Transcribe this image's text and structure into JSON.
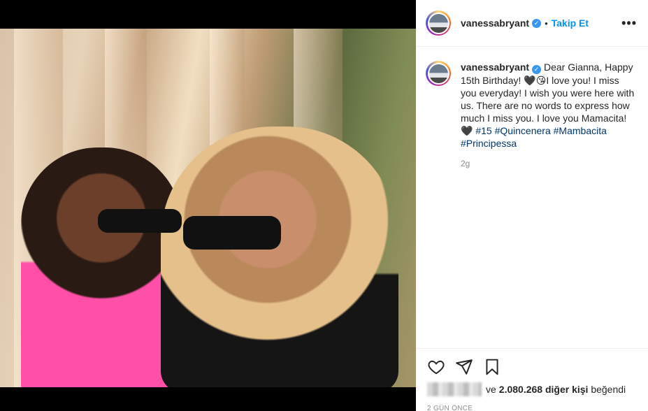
{
  "post": {
    "username": "vanessabryant",
    "follow_label": "Takip Et",
    "separator": "•",
    "more_label": "•••",
    "caption_username": "vanessabryant",
    "caption_text_1": "Dear Gianna, Happy 15th Birthday! ",
    "emoji_heart": "🖤",
    "emoji_kiss": "😘",
    "caption_text_2": "I love you! I miss you everyday! I wish you were here with us. There are no words to express how much I miss you. I love you Mamacita! ",
    "emoji_heart2": "🖤",
    "hashtags": [
      "#15",
      "#Quincenera",
      "#Mambacita",
      "#Principessa"
    ],
    "age": "2g",
    "likes_text": "ve ",
    "likes_count": "2.080.268 diğer kişi",
    "likes_suffix": " beğendi",
    "timestamp": "2 GÜN ÖNCE"
  },
  "icons": {
    "like": "heart-icon",
    "share": "send-icon",
    "save": "bookmark-icon",
    "verified": "verified-icon"
  },
  "colors": {
    "link": "#0095f6",
    "hashtag": "#00376b",
    "muted": "#8e8e8e",
    "text": "#262626"
  }
}
